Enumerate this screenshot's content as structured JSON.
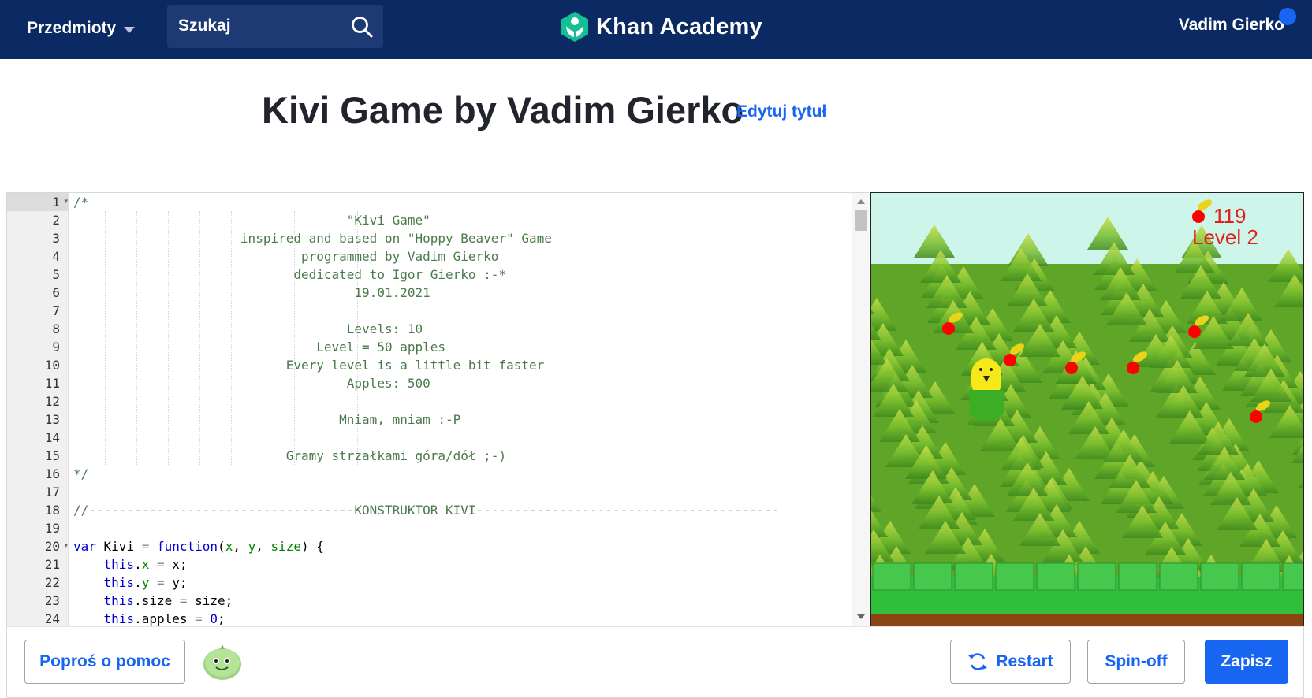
{
  "nav": {
    "subjects_label": "Przedmioty",
    "search_placeholder": "Szukaj",
    "logo_text": "Khan Academy",
    "user_name": "Vadim Gierko"
  },
  "page": {
    "title": "Kivi Game by Vadim Gierko",
    "edit_title_label": "Edytuj tytuł"
  },
  "editor": {
    "line_numbers": [
      "1",
      "2",
      "3",
      "4",
      "5",
      "6",
      "7",
      "8",
      "9",
      "10",
      "11",
      "12",
      "13",
      "14",
      "15",
      "16",
      "17",
      "18",
      "19",
      "20",
      "21",
      "22",
      "23",
      "24"
    ],
    "lines": [
      "/*",
      "                                    \"Kivi Game\"",
      "                      inspired and based on \"Hoppy Beaver\" Game",
      "                              programmed by Vadim Gierko",
      "                             dedicated to Igor Gierko :-*",
      "                                     19.01.2021",
      "",
      "                                    Levels: 10",
      "                                Level = 50 apples",
      "                            Every level is a little bit faster",
      "                                    Apples: 500",
      "",
      "                                   Mniam, mniam :-P",
      "",
      "                            Gramy strzałkami góra/dół ;-)",
      "*/",
      "",
      "//-----------------------------------KONSTRUKTOR KIVI----------------------------------------",
      "",
      "var Kivi = function(x, y, size) {",
      "    this.x = x;",
      "    this.y = y;",
      "    this.size = size;",
      "    this.apples = 0;"
    ]
  },
  "game": {
    "score": "119",
    "level_text": "Level 2"
  },
  "bottom": {
    "help_label": "Poproś o pomoc",
    "restart_label": "Restart",
    "spinoff_label": "Spin-off",
    "save_label": "Zapisz"
  },
  "colors": {
    "nav_bg": "#0b2a64",
    "accent": "#1865f2",
    "logo_green": "#14bf96",
    "game_text_red": "#e0201b",
    "sky": "#cdf5ea",
    "grass": "#2fbf3a",
    "dirt": "#8b4513"
  },
  "icons": [
    "chevron-down-icon",
    "search-icon",
    "khan-logo-icon",
    "refresh-icon",
    "avatar-icon",
    "apple-icon"
  ]
}
